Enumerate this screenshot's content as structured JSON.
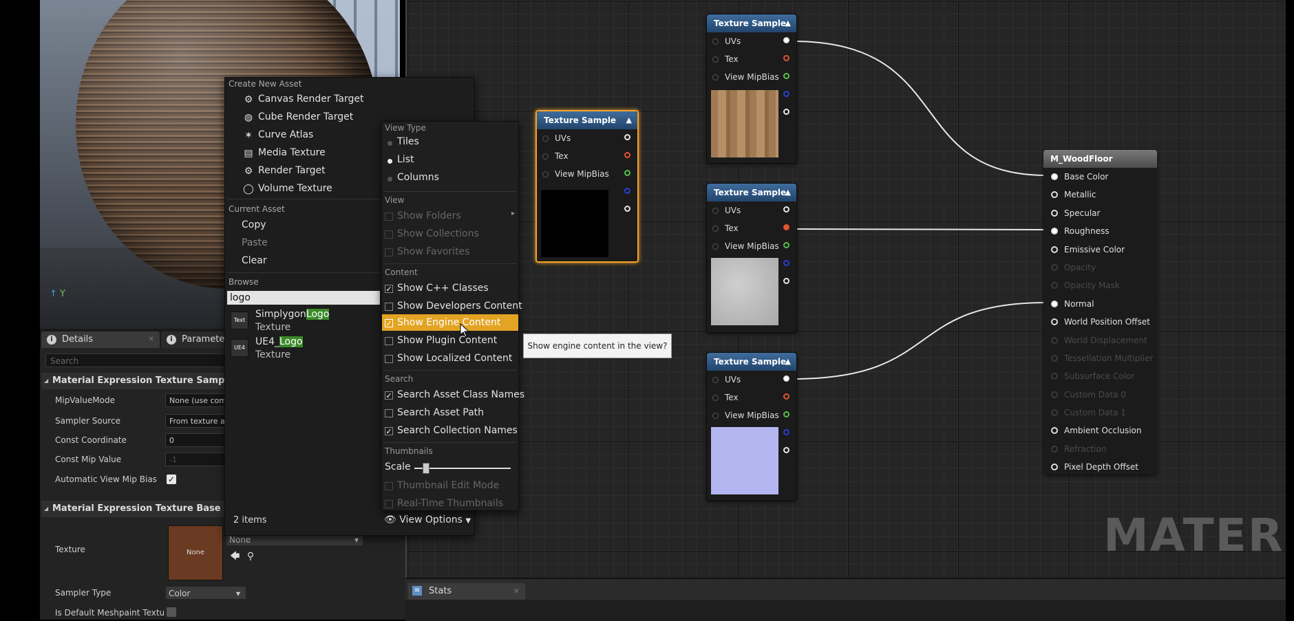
{
  "viewport": {
    "axis_label": "Y"
  },
  "graph": {
    "watermark": "MATERIAL",
    "texture_nodes": [
      {
        "title": "Texture Sample",
        "pins": [
          "UVs",
          "Tex",
          "View MipBias"
        ]
      },
      {
        "title": "Texture Sample",
        "pins": [
          "UVs",
          "Tex",
          "View MipBias"
        ]
      },
      {
        "title": "Texture Sample",
        "pins": [
          "UVs",
          "Tex",
          "View MipBias"
        ]
      },
      {
        "title": "Texture Sample",
        "pins": [
          "UVs",
          "Tex",
          "View MipBias"
        ]
      }
    ],
    "result_node": {
      "title": "M_WoodFloor",
      "pins": [
        "Base Color",
        "Metallic",
        "Specular",
        "Roughness",
        "Emissive Color",
        "Opacity",
        "Opacity Mask",
        "Normal",
        "World Position Offset",
        "World Displacement",
        "Tessellation Multiplier",
        "Subsurface Color",
        "Custom Data 0",
        "Custom Data 1",
        "Ambient Occlusion",
        "Refraction",
        "Pixel Depth Offset"
      ]
    }
  },
  "stats_tab": {
    "label": "Stats"
  },
  "details": {
    "tabs": {
      "details": "Details",
      "parameters": "Paramete"
    },
    "search_placeholder": "Search",
    "category_sample": "Material Expression Texture Sample",
    "category_base": "Material Expression Texture Base",
    "props": {
      "mip_value_mode": {
        "label": "MipValueMode",
        "value": "None (use com"
      },
      "sampler_source": {
        "label": "Sampler Source",
        "value": "From texture a"
      },
      "const_coordinate": {
        "label": "Const Coordinate",
        "value": "0"
      },
      "const_mip_value": {
        "label": "Const Mip Value",
        "value": "-1"
      },
      "auto_view_mip_bias": {
        "label": "Automatic View Mip Bias"
      },
      "texture": {
        "label": "Texture",
        "thumb_text": "None",
        "combo_value": "None"
      },
      "sampler_type": {
        "label": "Sampler Type",
        "value": "Color"
      },
      "is_default_meshpaint": {
        "label": "Is Default Meshpaint Textu"
      }
    }
  },
  "asset_menu": {
    "create_header": "Create New Asset",
    "create_items": [
      "Canvas Render Target",
      "Cube Render Target",
      "Curve Atlas",
      "Media Texture",
      "Render Target",
      "Volume Texture"
    ],
    "current_header": "Current Asset",
    "current_items": [
      "Copy",
      "Paste",
      "Clear"
    ],
    "browse_header": "Browse",
    "search_value": "logo",
    "results": [
      {
        "icon_text": "Text",
        "name_prefix": "Simplygon",
        "name_match": "Logo",
        "type": "Texture"
      },
      {
        "icon_text": "UE4",
        "name_prefix": "UE4_",
        "name_match": "Logo",
        "type": "Texture"
      }
    ],
    "items_count": "2 items",
    "view_options": "View Options"
  },
  "view_menu": {
    "view_type_header": "View Type",
    "view_types": [
      "Tiles",
      "List",
      "Columns"
    ],
    "view_header": "View",
    "view_items": [
      "Show Folders",
      "Show Collections",
      "Show Favorites"
    ],
    "content_header": "Content",
    "content_items": [
      "Show C++ Classes",
      "Show Developers Content",
      "Show Engine Content",
      "Show Plugin Content",
      "Show Localized Content"
    ],
    "search_header": "Search",
    "search_items": [
      "Search Asset Class Names",
      "Search Asset Path",
      "Search Collection Names"
    ],
    "thumbnails_header": "Thumbnails",
    "scale_label": "Scale",
    "thumbnail_items": [
      "Thumbnail Edit Mode",
      "Real-Time Thumbnails"
    ]
  },
  "tooltip": {
    "text": "Show engine content in the view?"
  }
}
